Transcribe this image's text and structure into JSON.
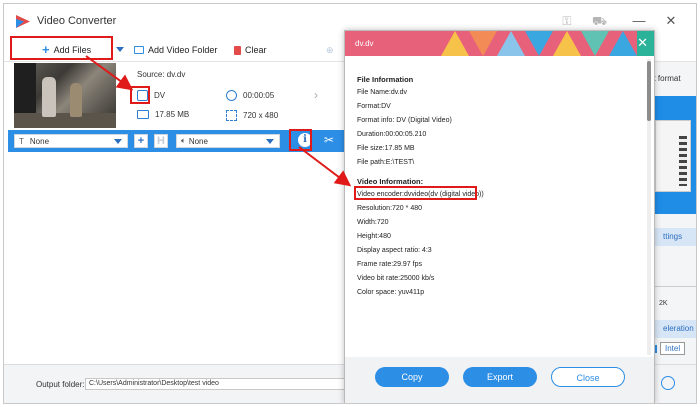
{
  "app": {
    "title": "Video Converter"
  },
  "toolbar": {
    "add_files": "Add Files",
    "add_video_folder": "Add Video Folder",
    "clear": "Clear"
  },
  "file": {
    "source": "Source: dv.dv",
    "format": "DV",
    "duration": "00:00:05",
    "size": "17.85 MB",
    "resolution": "720 x 480"
  },
  "edit_strip": {
    "subtitle_value": "None",
    "audio_value": "None"
  },
  "right_panel": {
    "output_format_partial": "ut format",
    "settings_partial": "ttings",
    "slider_tick": "2K",
    "acceleration_partial": "eleration",
    "intel_label": "Intel"
  },
  "bottom": {
    "output_folder_label": "Output folder:",
    "output_folder_value": "C:\\Users\\Administrator\\Desktop\\test video"
  },
  "dialog": {
    "title": "dv.dv",
    "file_info_title": "File Information",
    "file_info": [
      "File Name:dv.dv",
      "Format:DV",
      "Format info: DV (Digital Video)",
      "Duration:00:00:05.210",
      "File size:17.85 MB",
      "File path:E:\\TEST\\"
    ],
    "video_info_title": "Video Information:",
    "video_info": [
      "Video encoder:dvvideo(dv (digital video))",
      "Resolution:720 * 480",
      "Width:720",
      "Height:480",
      "Display aspect ratio: 4:3",
      "Frame rate:29.97 fps",
      "Video bit rate:25000 kb/s",
      "Color space: yuv411p"
    ],
    "buttons": {
      "copy": "Copy",
      "export": "Export",
      "close": "Close"
    }
  },
  "colors": {
    "accent_blue": "#2d8ee6",
    "dialog_header": "#e8617a",
    "highlight_red": "#e01919"
  }
}
